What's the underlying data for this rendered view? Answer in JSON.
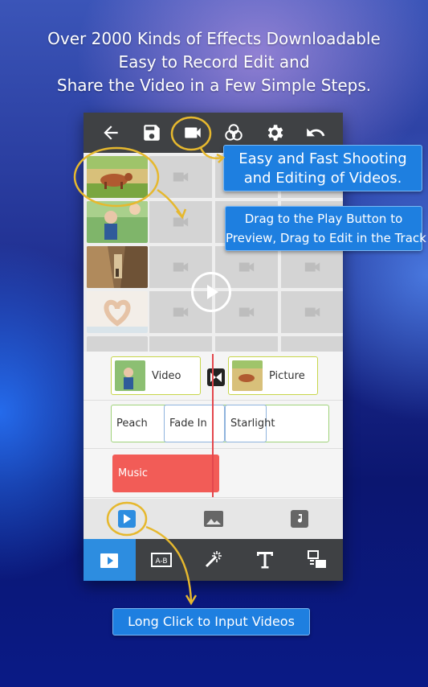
{
  "headline": {
    "line1": "Over 2000 Kinds of Effects Downloadable",
    "line2": "Easy to Record Edit and",
    "line3": "Share the Video in a Few Simple Steps."
  },
  "toolbar": {
    "icons": [
      "back-arrow-icon",
      "save-icon",
      "camera-icon",
      "color-filter-icon",
      "gear-icon",
      "undo-icon"
    ],
    "accent_color": "#e6b82e"
  },
  "callouts": {
    "shooting_line1": "Easy and Fast Shooting",
    "shooting_line2": "and Editing of Videos.",
    "drag_line1": "Drag to the Play Button to",
    "drag_line2": "Preview, Drag to Edit in the Track",
    "long_click": "Long Click to Input Videos"
  },
  "timeline": {
    "video_label": "Video",
    "picture_label": "Picture",
    "effects": [
      "Peach",
      "Fade In",
      "Starlight"
    ],
    "music_label": "Music"
  },
  "colors": {
    "toolbar_bg": "#3f4144",
    "active_tab": "#2d8de0",
    "callout_bg": "#1e7fe0",
    "music_clip": "#f25c57",
    "playhead": "#e4474d"
  }
}
